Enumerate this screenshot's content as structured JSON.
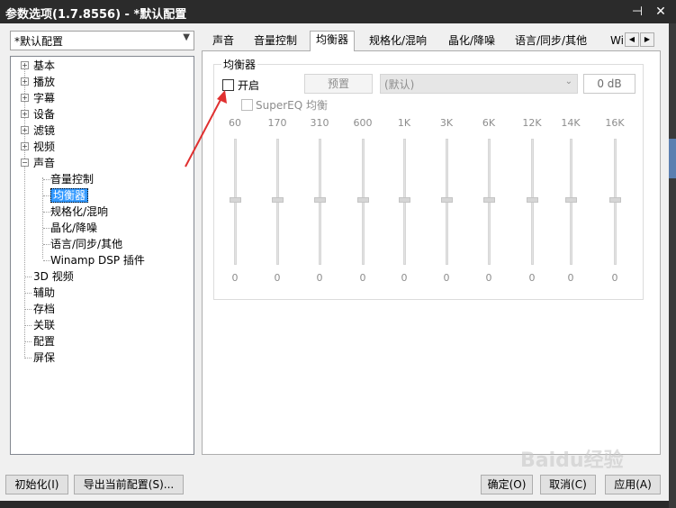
{
  "window": {
    "title": "参数选项(1.7.8556) - *默认配置",
    "pin_glyph": "⊣",
    "close_glyph": "✕"
  },
  "profile": {
    "selected": "*默认配置"
  },
  "tree": {
    "items": [
      {
        "label": "基本",
        "expand": "+"
      },
      {
        "label": "播放",
        "expand": "+"
      },
      {
        "label": "字幕",
        "expand": "+"
      },
      {
        "label": "设备",
        "expand": "+"
      },
      {
        "label": "滤镜",
        "expand": "+"
      },
      {
        "label": "视频",
        "expand": "+"
      },
      {
        "label": "声音",
        "expand": "−"
      },
      {
        "label": "音量控制"
      },
      {
        "label": "均衡器",
        "selected": true
      },
      {
        "label": "规格化/混响"
      },
      {
        "label": "晶化/降噪"
      },
      {
        "label": "语言/同步/其他"
      },
      {
        "label": "Winamp DSP 插件"
      },
      {
        "label": "3D 视频"
      },
      {
        "label": "辅助"
      },
      {
        "label": "存档"
      },
      {
        "label": "关联"
      },
      {
        "label": "配置"
      },
      {
        "label": "屏保"
      }
    ]
  },
  "tabs": [
    {
      "label": "声音"
    },
    {
      "label": "音量控制"
    },
    {
      "label": "均衡器",
      "active": true
    },
    {
      "label": "规格化/混响"
    },
    {
      "label": "晶化/降噪"
    },
    {
      "label": "语言/同步/其他"
    },
    {
      "label": "Wi"
    }
  ],
  "tab_scroll": {
    "left": "◀",
    "right": "▶"
  },
  "equalizer": {
    "group_title": "均衡器",
    "enable_label": "开启",
    "enable_checked": false,
    "supereq_label": "SuperEQ 均衡",
    "preset_button": "预置",
    "preset_value": "(默认)",
    "gain_value": "0 dB",
    "bands": [
      {
        "freq": "60",
        "value": "0"
      },
      {
        "freq": "170",
        "value": "0"
      },
      {
        "freq": "310",
        "value": "0"
      },
      {
        "freq": "600",
        "value": "0"
      },
      {
        "freq": "1K",
        "value": "0"
      },
      {
        "freq": "3K",
        "value": "0"
      },
      {
        "freq": "6K",
        "value": "0"
      },
      {
        "freq": "12K",
        "value": "0"
      },
      {
        "freq": "14K",
        "value": "0"
      },
      {
        "freq": "16K",
        "value": "0"
      }
    ]
  },
  "footer": {
    "init_button": "初始化(I)",
    "export_button": "导出当前配置(S)...",
    "ok_button": "确定(O)",
    "cancel_button": "取消(C)",
    "apply_button": "应用(A)"
  },
  "watermark": "Baidu经验",
  "colors": {
    "titlebar": "#2b2b2b",
    "selection": "#3399ff",
    "annotation_arrow": "#e03030"
  }
}
